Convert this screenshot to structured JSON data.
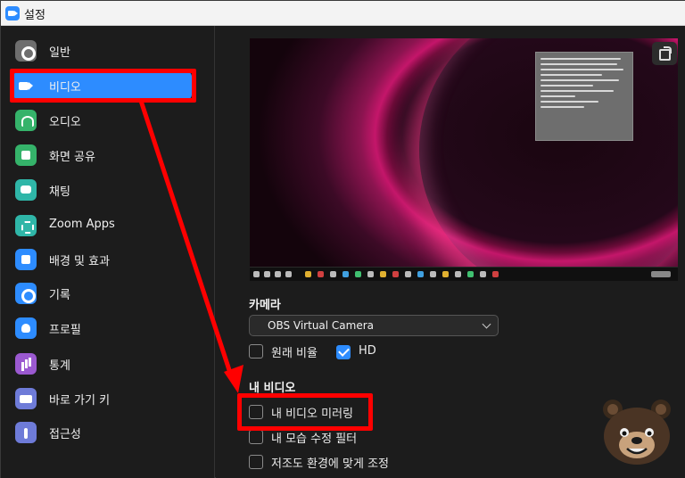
{
  "window": {
    "title": "설정",
    "accent": "#2d8cff",
    "annotation_color": "#ff0000"
  },
  "sidebar": {
    "items": [
      {
        "label": "일반",
        "icon": "gear-icon",
        "active": false
      },
      {
        "label": "비디오",
        "icon": "video-camera-icon",
        "active": true
      },
      {
        "label": "오디오",
        "icon": "headphones-icon",
        "active": false
      },
      {
        "label": "화면 공유",
        "icon": "share-screen-icon",
        "active": false
      },
      {
        "label": "채팅",
        "icon": "chat-bubble-icon",
        "active": false
      },
      {
        "label": "Zoom Apps",
        "icon": "apps-icon",
        "active": false
      },
      {
        "label": "배경 및 효과",
        "icon": "background-person-icon",
        "active": false
      },
      {
        "label": "기록",
        "icon": "record-icon",
        "active": false
      },
      {
        "label": "프로필",
        "icon": "profile-icon",
        "active": false
      },
      {
        "label": "통계",
        "icon": "bar-chart-icon",
        "active": false
      },
      {
        "label": "바로 가기 키",
        "icon": "keyboard-icon",
        "active": false
      },
      {
        "label": "접근성",
        "icon": "accessibility-icon",
        "active": false
      }
    ]
  },
  "video": {
    "camera_heading": "카메라",
    "camera_value": "OBS Virtual Camera",
    "original_ratio": {
      "label": "원래 비율",
      "checked": false
    },
    "hd": {
      "label": "HD",
      "checked": true
    },
    "my_video_heading": "내 비디오",
    "mirror": {
      "label": "내 비디오 미러링",
      "checked": false
    },
    "touch_up": {
      "label": "내 모습 수정 필터",
      "checked": false
    },
    "low_light": {
      "label": "저조도 환경에 맞게 조정",
      "checked": false
    }
  }
}
